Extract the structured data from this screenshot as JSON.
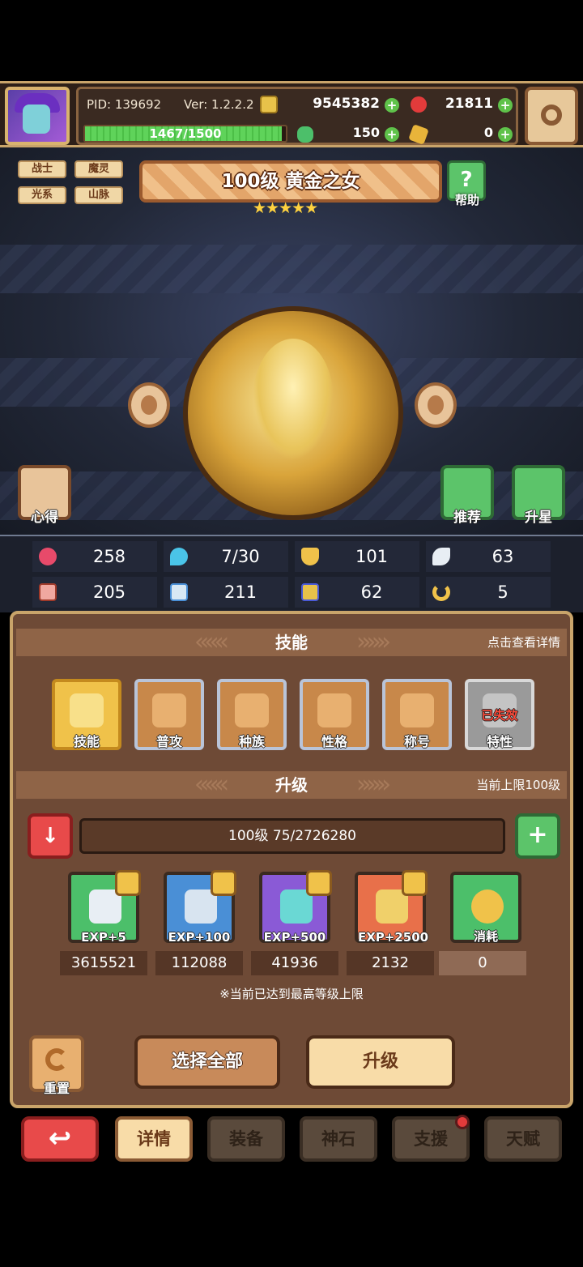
{
  "header": {
    "pid": "PID: 139692",
    "version": "Ver: 1.2.2.2",
    "gold": "9545382",
    "gems": "21811",
    "exp_text": "1467/1500",
    "exp_progress": 0.978,
    "stamina": "150",
    "keys": "0"
  },
  "tags": [
    "战士",
    "魔灵",
    "光系",
    "山脉"
  ],
  "hero": {
    "title": "100级 黄金之女",
    "stars": 5,
    "stars_text": "★★★★★"
  },
  "help_label": "帮助",
  "side_buttons": {
    "notes": "心得",
    "recommend": "推荐",
    "star_up": "升星"
  },
  "stats": [
    {
      "icon": "heart-icon",
      "value": "258"
    },
    {
      "icon": "water-drop-icon",
      "value": "7/30"
    },
    {
      "icon": "shield-icon",
      "value": "101"
    },
    {
      "icon": "wing-icon",
      "value": "63"
    },
    {
      "icon": "fist-icon",
      "value": "205"
    },
    {
      "icon": "book-icon",
      "value": "211"
    },
    {
      "icon": "scroll-icon",
      "value": "62"
    },
    {
      "icon": "horseshoe-icon",
      "value": "5"
    }
  ],
  "skills_section": {
    "title": "技能",
    "link": "点击查看详情"
  },
  "skills": [
    {
      "label": "技能"
    },
    {
      "label": "普攻"
    },
    {
      "label": "种族"
    },
    {
      "label": "性格"
    },
    {
      "label": "称号"
    },
    {
      "label": "特性",
      "status": "已失效"
    }
  ],
  "upgrade_section": {
    "title": "升级",
    "limit": "当前上限100级"
  },
  "level_bar": "100级 75/2726280",
  "exp_items": [
    {
      "label": "EXP+5",
      "count": "3615521",
      "color": "#4cbf6a"
    },
    {
      "label": "EXP+100",
      "count": "112088",
      "color": "#4a8fd6"
    },
    {
      "label": "EXP+500",
      "count": "41936",
      "color": "#8a5ad6"
    },
    {
      "label": "EXP+2500",
      "count": "2132",
      "color": "#e8704a"
    },
    {
      "label": "消耗",
      "count": "0",
      "color": "#4cbf6a"
    }
  ],
  "note": "※当前已达到最高等级上限",
  "actions": {
    "reset": "重置",
    "select_all": "选择全部",
    "upgrade": "升级"
  },
  "tabs": [
    "详情",
    "装备",
    "神石",
    "支援",
    "天赋"
  ]
}
